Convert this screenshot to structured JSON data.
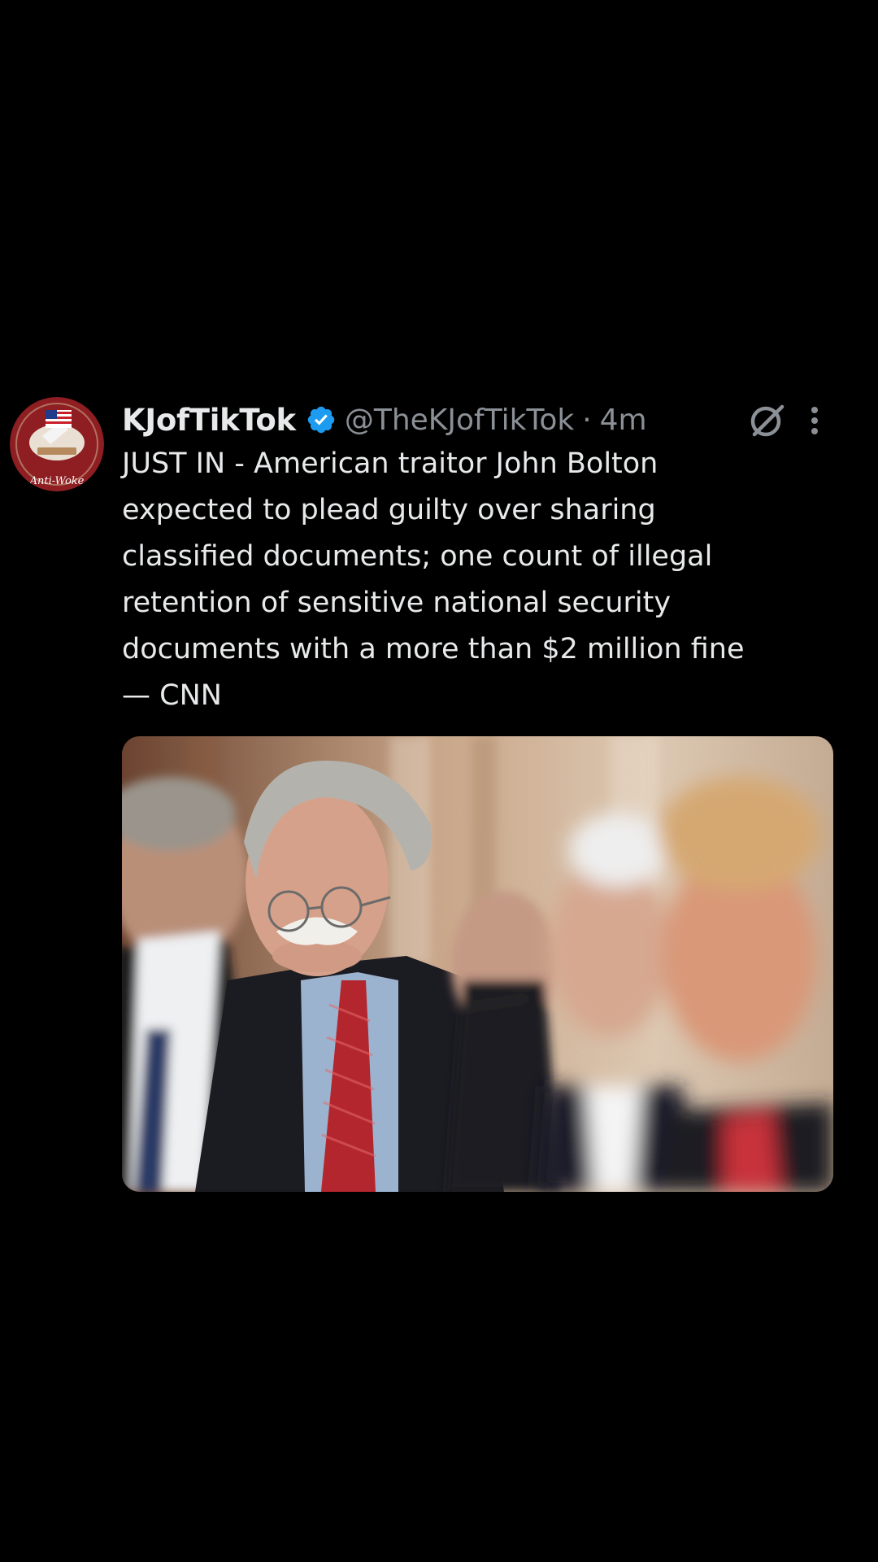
{
  "tweet": {
    "avatar": {
      "badge_text": "Anti-Woke"
    },
    "display_name": "KJofTikTok",
    "verified": true,
    "handle": "@TheKJofTikTok",
    "separator": "·",
    "timestamp": "4m",
    "text_lines": [
      "JUST IN - American traitor John Bolton",
      "expected to plead guilty over sharing",
      "classified documents; one count of illegal",
      "retention of sensitive national security",
      "documents with a more than $2 million fine",
      "— CNN"
    ],
    "icons": {
      "grok": "grok-icon",
      "more": "more-vertical-icon",
      "verified": "verified-badge-icon"
    }
  },
  "colors": {
    "background": "#000000",
    "text_primary": "#e7e9ea",
    "text_secondary": "#8b9096",
    "verified_blue": "#1d9bf0"
  }
}
